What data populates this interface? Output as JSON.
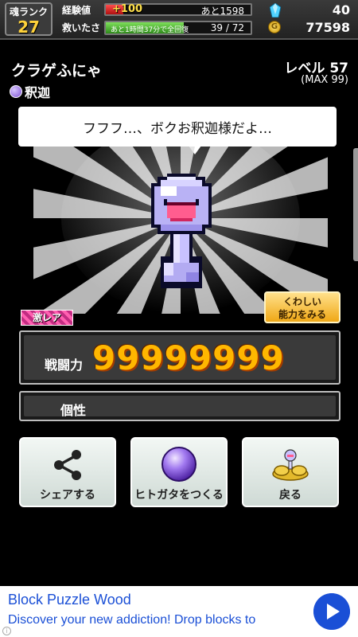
{
  "status": {
    "rank_label": "魂ランク",
    "rank_value": "27",
    "exp_label": "経験値",
    "exp_gain": "+100",
    "exp_remaining": "あと1598",
    "exp_fill": 0.12,
    "saved_label": "救いたさ",
    "saved_note": "あと1時間37分で全回復",
    "saved_count": "39 / 72",
    "saved_fill": 0.54,
    "gems": "40",
    "coins": "77598"
  },
  "character": {
    "name": "クラゲふにゃ",
    "type": "釈迦",
    "level": "レベル 57",
    "max_level": "(MAX 99)",
    "speech": "フフフ…、ボクお釈迦様だよ…",
    "rarity": "激レア",
    "detail_button": [
      "くわしい",
      "能力をみる"
    ]
  },
  "stats": {
    "power_label": "戦闘力",
    "power_value": "99999999",
    "trait_label": "個性"
  },
  "actions": {
    "share": "シェアする",
    "make_vessel": "ヒトガタをつくる",
    "back": "戻る"
  },
  "ad": {
    "title": "Block Puzzle Wood",
    "description": "Discover your new addiction! Drop blocks to"
  },
  "colors": {
    "power": "#ffb700",
    "exp_bar": "#e02a2a",
    "saved_bar": "#58c23a",
    "detail_button": "#f4b52a",
    "ad_link": "#1a4fd6"
  }
}
